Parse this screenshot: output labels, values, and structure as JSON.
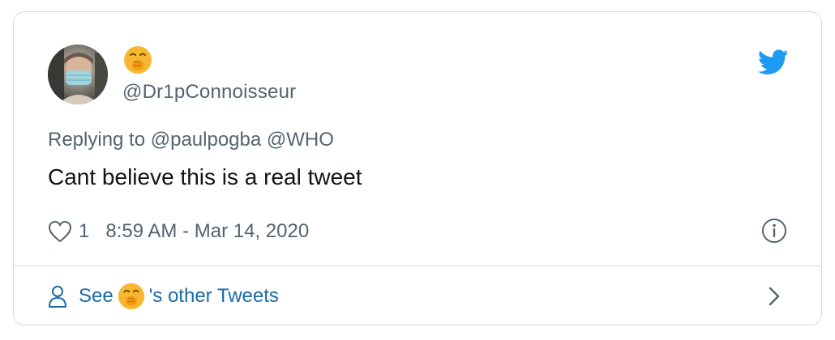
{
  "author": {
    "display_name_icon": "yawning-face-emoji-icon",
    "handle": "@Dr1pConnoisseur",
    "avatar": "profile-photo-masked-person"
  },
  "reply": {
    "prefix": "Replying to",
    "mentions": [
      "@paulpogba",
      "@WHO"
    ]
  },
  "tweet": {
    "text": "Cant believe this is a real tweet"
  },
  "meta": {
    "like_count": "1",
    "timestamp": "8:59 AM - Mar 14, 2020"
  },
  "footer": {
    "see_label": "See",
    "suffix_label": "'s other Tweets"
  },
  "colors": {
    "twitter_blue": "#1d9bf0",
    "link_blue": "#1b6ba8",
    "muted_text": "#536471",
    "border": "#cfd9de",
    "emoji_yellow": "#f7b731"
  }
}
